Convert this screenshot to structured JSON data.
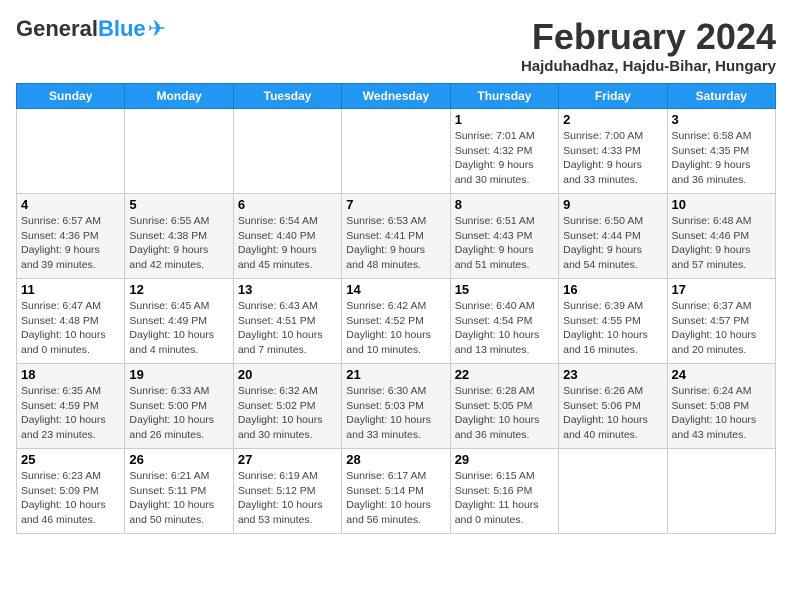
{
  "logo": {
    "general": "General",
    "blue": "Blue"
  },
  "header": {
    "month": "February 2024",
    "location": "Hajduhadhaz, Hajdu-Bihar, Hungary"
  },
  "weekdays": [
    "Sunday",
    "Monday",
    "Tuesday",
    "Wednesday",
    "Thursday",
    "Friday",
    "Saturday"
  ],
  "weeks": [
    [
      {
        "day": "",
        "info": ""
      },
      {
        "day": "",
        "info": ""
      },
      {
        "day": "",
        "info": ""
      },
      {
        "day": "",
        "info": ""
      },
      {
        "day": "1",
        "info": "Sunrise: 7:01 AM\nSunset: 4:32 PM\nDaylight: 9 hours\nand 30 minutes."
      },
      {
        "day": "2",
        "info": "Sunrise: 7:00 AM\nSunset: 4:33 PM\nDaylight: 9 hours\nand 33 minutes."
      },
      {
        "day": "3",
        "info": "Sunrise: 6:58 AM\nSunset: 4:35 PM\nDaylight: 9 hours\nand 36 minutes."
      }
    ],
    [
      {
        "day": "4",
        "info": "Sunrise: 6:57 AM\nSunset: 4:36 PM\nDaylight: 9 hours\nand 39 minutes."
      },
      {
        "day": "5",
        "info": "Sunrise: 6:55 AM\nSunset: 4:38 PM\nDaylight: 9 hours\nand 42 minutes."
      },
      {
        "day": "6",
        "info": "Sunrise: 6:54 AM\nSunset: 4:40 PM\nDaylight: 9 hours\nand 45 minutes."
      },
      {
        "day": "7",
        "info": "Sunrise: 6:53 AM\nSunset: 4:41 PM\nDaylight: 9 hours\nand 48 minutes."
      },
      {
        "day": "8",
        "info": "Sunrise: 6:51 AM\nSunset: 4:43 PM\nDaylight: 9 hours\nand 51 minutes."
      },
      {
        "day": "9",
        "info": "Sunrise: 6:50 AM\nSunset: 4:44 PM\nDaylight: 9 hours\nand 54 minutes."
      },
      {
        "day": "10",
        "info": "Sunrise: 6:48 AM\nSunset: 4:46 PM\nDaylight: 9 hours\nand 57 minutes."
      }
    ],
    [
      {
        "day": "11",
        "info": "Sunrise: 6:47 AM\nSunset: 4:48 PM\nDaylight: 10 hours\nand 0 minutes."
      },
      {
        "day": "12",
        "info": "Sunrise: 6:45 AM\nSunset: 4:49 PM\nDaylight: 10 hours\nand 4 minutes."
      },
      {
        "day": "13",
        "info": "Sunrise: 6:43 AM\nSunset: 4:51 PM\nDaylight: 10 hours\nand 7 minutes."
      },
      {
        "day": "14",
        "info": "Sunrise: 6:42 AM\nSunset: 4:52 PM\nDaylight: 10 hours\nand 10 minutes."
      },
      {
        "day": "15",
        "info": "Sunrise: 6:40 AM\nSunset: 4:54 PM\nDaylight: 10 hours\nand 13 minutes."
      },
      {
        "day": "16",
        "info": "Sunrise: 6:39 AM\nSunset: 4:55 PM\nDaylight: 10 hours\nand 16 minutes."
      },
      {
        "day": "17",
        "info": "Sunrise: 6:37 AM\nSunset: 4:57 PM\nDaylight: 10 hours\nand 20 minutes."
      }
    ],
    [
      {
        "day": "18",
        "info": "Sunrise: 6:35 AM\nSunset: 4:59 PM\nDaylight: 10 hours\nand 23 minutes."
      },
      {
        "day": "19",
        "info": "Sunrise: 6:33 AM\nSunset: 5:00 PM\nDaylight: 10 hours\nand 26 minutes."
      },
      {
        "day": "20",
        "info": "Sunrise: 6:32 AM\nSunset: 5:02 PM\nDaylight: 10 hours\nand 30 minutes."
      },
      {
        "day": "21",
        "info": "Sunrise: 6:30 AM\nSunset: 5:03 PM\nDaylight: 10 hours\nand 33 minutes."
      },
      {
        "day": "22",
        "info": "Sunrise: 6:28 AM\nSunset: 5:05 PM\nDaylight: 10 hours\nand 36 minutes."
      },
      {
        "day": "23",
        "info": "Sunrise: 6:26 AM\nSunset: 5:06 PM\nDaylight: 10 hours\nand 40 minutes."
      },
      {
        "day": "24",
        "info": "Sunrise: 6:24 AM\nSunset: 5:08 PM\nDaylight: 10 hours\nand 43 minutes."
      }
    ],
    [
      {
        "day": "25",
        "info": "Sunrise: 6:23 AM\nSunset: 5:09 PM\nDaylight: 10 hours\nand 46 minutes."
      },
      {
        "day": "26",
        "info": "Sunrise: 6:21 AM\nSunset: 5:11 PM\nDaylight: 10 hours\nand 50 minutes."
      },
      {
        "day": "27",
        "info": "Sunrise: 6:19 AM\nSunset: 5:12 PM\nDaylight: 10 hours\nand 53 minutes."
      },
      {
        "day": "28",
        "info": "Sunrise: 6:17 AM\nSunset: 5:14 PM\nDaylight: 10 hours\nand 56 minutes."
      },
      {
        "day": "29",
        "info": "Sunrise: 6:15 AM\nSunset: 5:16 PM\nDaylight: 11 hours\nand 0 minutes."
      },
      {
        "day": "",
        "info": ""
      },
      {
        "day": "",
        "info": ""
      }
    ]
  ]
}
